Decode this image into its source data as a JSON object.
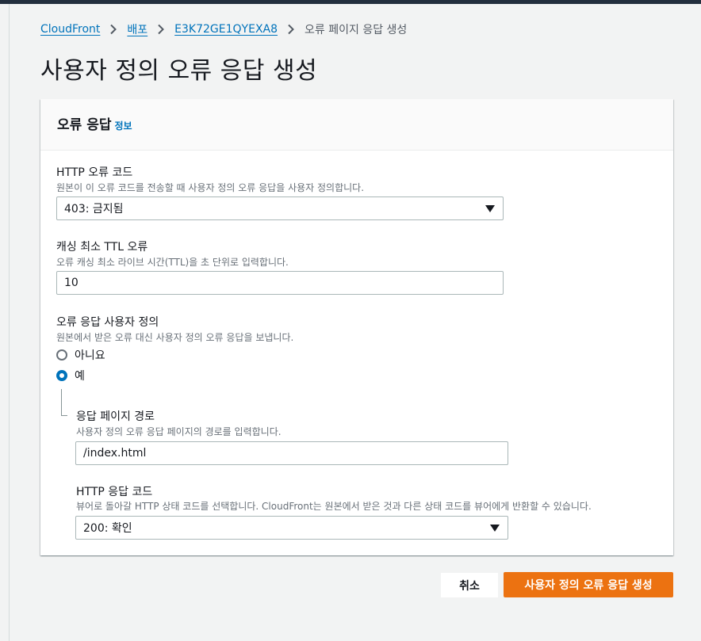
{
  "breadcrumb": {
    "items": [
      "CloudFront",
      "배포",
      "E3K72GE1QYEXA8"
    ],
    "current": "오류 페이지 응답 생성"
  },
  "page_title": "사용자 정의 오류 응답 생성",
  "panel": {
    "title": "오류 응답",
    "info_link": "정보"
  },
  "http_error_code": {
    "label": "HTTP 오류 코드",
    "description": "원본이 이 오류 코드를 전송할 때 사용자 정의 오류 응답을 사용자 정의합니다.",
    "value": "403: 금지됨"
  },
  "min_ttl": {
    "label": "캐싱 최소 TTL 오류",
    "description": "오류 캐싱 최소 라이브 시간(TTL)을 초 단위로 입력합니다.",
    "value": "10"
  },
  "customize": {
    "label": "오류 응답 사용자 정의",
    "description": "원본에서 받은 오류 대신 사용자 정의 오류 응답을 보냅니다.",
    "option_no": "아니요",
    "option_yes": "예",
    "selected": "예"
  },
  "response_page_path": {
    "label": "응답 페이지 경로",
    "description": "사용자 정의 오류 응답 페이지의 경로를 입력합니다.",
    "value": "/index.html"
  },
  "http_response_code": {
    "label": "HTTP 응답 코드",
    "description": "뷰어로 돌아갈 HTTP 상태 코드를 선택합니다. CloudFront는 원본에서 받은 것과 다른 상태 코드를 뷰어에게 반환할 수 있습니다.",
    "value": "200: 확인"
  },
  "actions": {
    "cancel": "취소",
    "submit": "사용자 정의 오류 응답 생성"
  },
  "colors": {
    "link": "#0073bb",
    "primary_button": "#ec7211",
    "radio_selected": "#0073bb"
  }
}
